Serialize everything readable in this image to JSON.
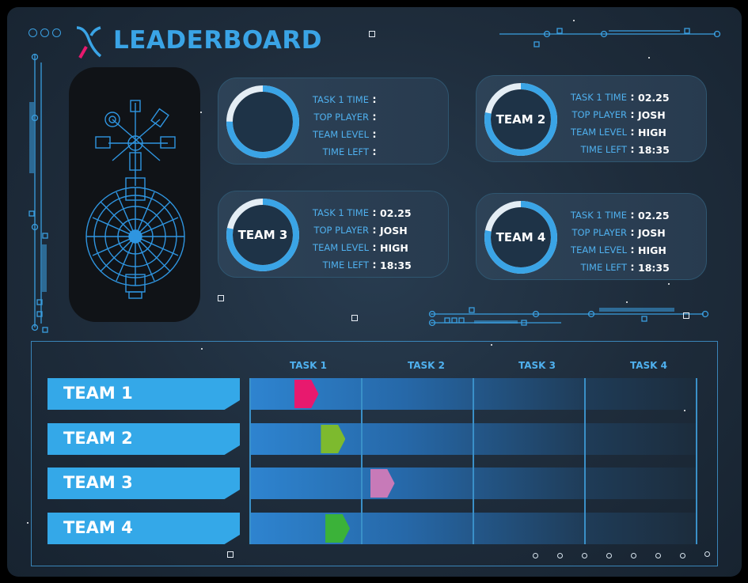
{
  "header": {
    "title": "LEADERBOARD",
    "logo_icon": "x-logo-icon"
  },
  "colors": {
    "accent": "#3aa4e6",
    "background": "#1e2c3b",
    "team1_marker": "#e8196e",
    "team2_marker": "#7dba2e",
    "team3_marker": "#c77ab8",
    "team4_marker": "#3bb239"
  },
  "summary_cards": [
    {
      "team": "",
      "ring_progress": 0.75,
      "labels": [
        "TASK 1 TIME",
        "TOP PLAYER",
        "TEAM LEVEL",
        "TIME LEFT"
      ],
      "values": [
        "",
        "",
        "",
        ""
      ]
    },
    {
      "team": "TEAM 2",
      "ring_progress": 0.78,
      "labels": [
        "TASK 1 TIME",
        "TOP PLAYER",
        "TEAM LEVEL",
        "TIME LEFT"
      ],
      "values": [
        "02.25",
        "JOSH",
        "HIGH",
        "18:35"
      ]
    },
    {
      "team": "TEAM 3",
      "ring_progress": 0.78,
      "labels": [
        "TASK 1 TIME",
        "TOP PLAYER",
        "TEAM LEVEL",
        "TIME LEFT"
      ],
      "values": [
        "02.25",
        "JOSH",
        "HIGH",
        "18:35"
      ]
    },
    {
      "team": "TEAM 4",
      "ring_progress": 0.78,
      "labels": [
        "TASK 1 TIME",
        "TOP PLAYER",
        "TEAM LEVEL",
        "TIME LEFT"
      ],
      "values": [
        "02.25",
        "JOSH",
        "HIGH",
        "18:35"
      ]
    }
  ],
  "progress_board": {
    "task_headers": [
      "TASK 1",
      "TASK 2",
      "TASK 3",
      "TASK 4"
    ],
    "teams": [
      {
        "name": "TEAM 1",
        "progress": 0.1
      },
      {
        "name": "TEAM 2",
        "progress": 0.16
      },
      {
        "name": "TEAM 3",
        "progress": 0.27
      },
      {
        "name": "TEAM 4",
        "progress": 0.17
      }
    ]
  }
}
